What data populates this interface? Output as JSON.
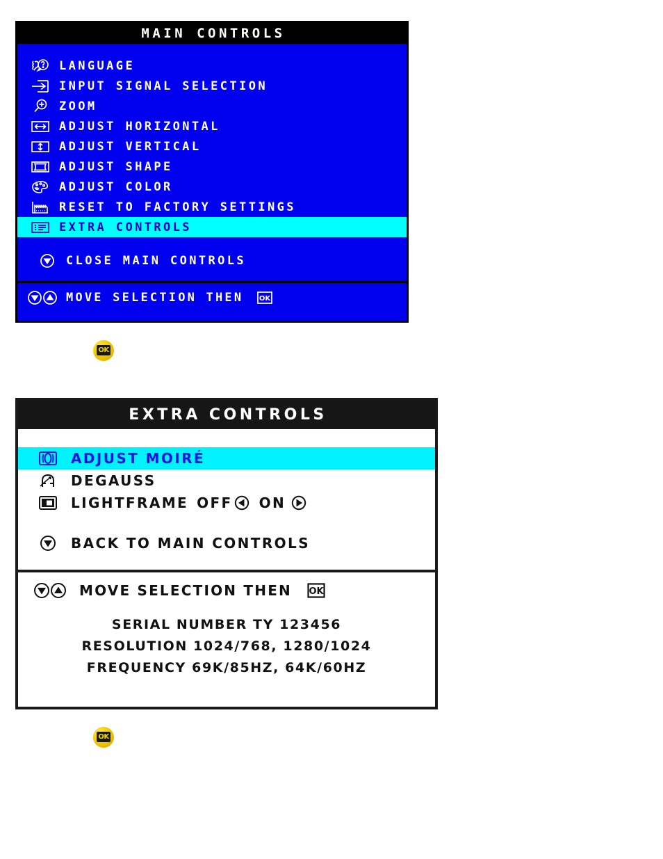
{
  "colors": {
    "osd_blue": "#0000ee",
    "highlight_cyan": "#00ffff",
    "selected_text_blue": "#0000cc",
    "black": "#000000",
    "white": "#ffffff",
    "ok_button_gold": "#f5cc00"
  },
  "main_controls": {
    "title": "MAIN CONTROLS",
    "items": [
      {
        "icon": "language-icon",
        "label": "LANGUAGE",
        "selected": false
      },
      {
        "icon": "input-signal-icon",
        "label": "INPUT SIGNAL SELECTION",
        "selected": false
      },
      {
        "icon": "zoom-icon",
        "label": "ZOOM",
        "selected": false
      },
      {
        "icon": "adjust-horizontal-icon",
        "label": "ADJUST HORIZONTAL",
        "selected": false
      },
      {
        "icon": "adjust-vertical-icon",
        "label": "ADJUST VERTICAL",
        "selected": false
      },
      {
        "icon": "adjust-shape-icon",
        "label": "ADJUST SHAPE",
        "selected": false
      },
      {
        "icon": "adjust-color-icon",
        "label": "ADJUST COLOR",
        "selected": false
      },
      {
        "icon": "reset-factory-icon",
        "label": "RESET TO FACTORY SETTINGS",
        "selected": false
      },
      {
        "icon": "extra-controls-icon",
        "label": "EXTRA CONTROLS",
        "selected": true
      }
    ],
    "close_item": {
      "icon": "down-arrow-icon",
      "label": "CLOSE MAIN CONTROLS"
    },
    "footer": {
      "icon_down": "down-arrow-icon",
      "icon_up": "up-arrow-icon",
      "label": "MOVE SELECTION THEN",
      "ok_icon": "ok-icon"
    }
  },
  "ok_button_1": {
    "label": "OK",
    "name": "ok-button"
  },
  "extra_controls": {
    "title": "EXTRA CONTROLS",
    "items": [
      {
        "icon": "moire-icon",
        "label": "ADJUST MOIRÉ",
        "selected": true
      },
      {
        "icon": "degauss-icon",
        "label": "DEGAUSS",
        "selected": false
      }
    ],
    "lightframe": {
      "icon": "lightframe-icon",
      "label": "LIGHTFRAME",
      "off_label": "OFF",
      "left_arrow_icon": "left-arrow-icon",
      "on_label": "ON",
      "right_arrow_icon": "right-arrow-icon"
    },
    "back_item": {
      "icon": "down-arrow-icon",
      "label": "BACK TO MAIN CONTROLS"
    },
    "footer": {
      "icon_down": "down-arrow-icon",
      "icon_up": "up-arrow-icon",
      "label": "MOVE SELECTION THEN",
      "ok_icon": "ok-icon"
    },
    "info": {
      "serial": "SERIAL NUMBER TY 123456",
      "resolution": "RESOLUTION 1024/768, 1280/1024",
      "frequency": "FREQUENCY 69K/85HZ, 64K/60HZ"
    }
  },
  "ok_button_2": {
    "label": "OK",
    "name": "ok-button"
  }
}
